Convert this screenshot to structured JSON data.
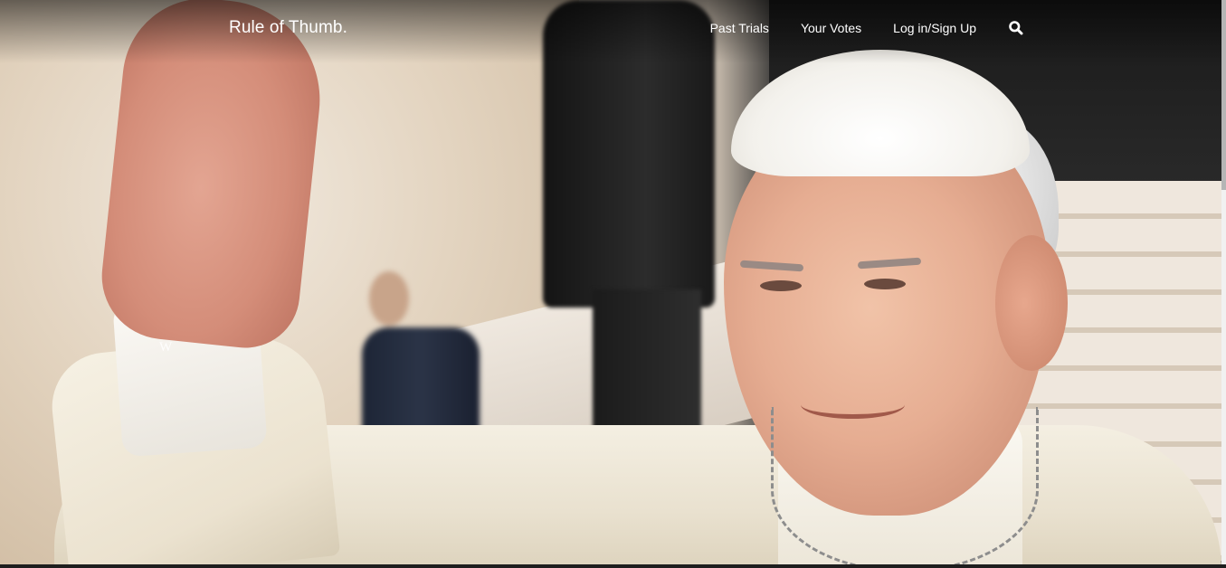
{
  "brand": {
    "name": "Rule of Thumb."
  },
  "nav": {
    "items": [
      {
        "label": "Past Trials"
      },
      {
        "label": "Your Votes"
      },
      {
        "label": "Log in/Sign Up"
      }
    ],
    "search_icon": "search-icon"
  },
  "hero": {
    "image_subject": "pope-francis-waving-photo",
    "watermark": "W"
  },
  "colors": {
    "nav_text": "#ffffff",
    "robe": "#f4efe2"
  }
}
